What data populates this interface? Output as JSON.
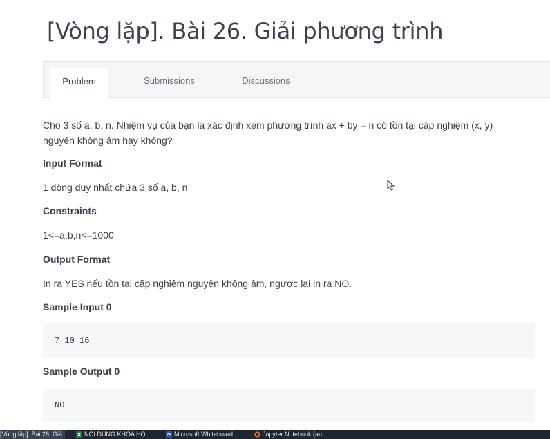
{
  "title": "[Vòng lặp]. Bài 26. Giải phương trình",
  "tabs": [
    {
      "label": "Problem",
      "active": true
    },
    {
      "label": "Submissions",
      "active": false
    },
    {
      "label": "Discussions",
      "active": false
    }
  ],
  "problem": {
    "description_line1": "Cho 3 số a, b, n. Nhiệm vụ của bạn là xác định xem phương trình ax + by = n có tồn tại cặp nghiệm (x, y)",
    "description_line2": "nguyên không âm hay không?",
    "input_format_heading": "Input Format",
    "input_format_text": "1 dòng duy nhất chứa 3 số a, b, n",
    "constraints_heading": "Constraints",
    "constraints_text": "1<=a,b,n<=1000",
    "output_format_heading": "Output Format",
    "output_format_text": "In ra YES nếu tồn tại cặp nghiệm nguyên không âm, ngược lại in ra NO.",
    "sample_input_heading": "Sample Input 0",
    "sample_input_value": "7 10 16",
    "sample_output_heading": "Sample Output 0",
    "sample_output_value": "NO"
  },
  "taskbar": {
    "items": [
      {
        "label": "[Vòng lặp]. Bài 26. Giả",
        "icon": "browser-icon"
      },
      {
        "label": "NỘI DUNG KHÓA HỌ",
        "icon": "excel-icon"
      },
      {
        "label": "Microsoft Whiteboard",
        "icon": "whiteboard-icon"
      },
      {
        "label": "Jupyter Notebook (an",
        "icon": "jupyter-icon"
      }
    ]
  },
  "colors": {
    "text": "#39424e",
    "muted": "#6a737c",
    "code_bg": "#f6f7f8",
    "tab_bar_bg": "#f5f6f7",
    "taskbar_bg": "#1f2633"
  }
}
